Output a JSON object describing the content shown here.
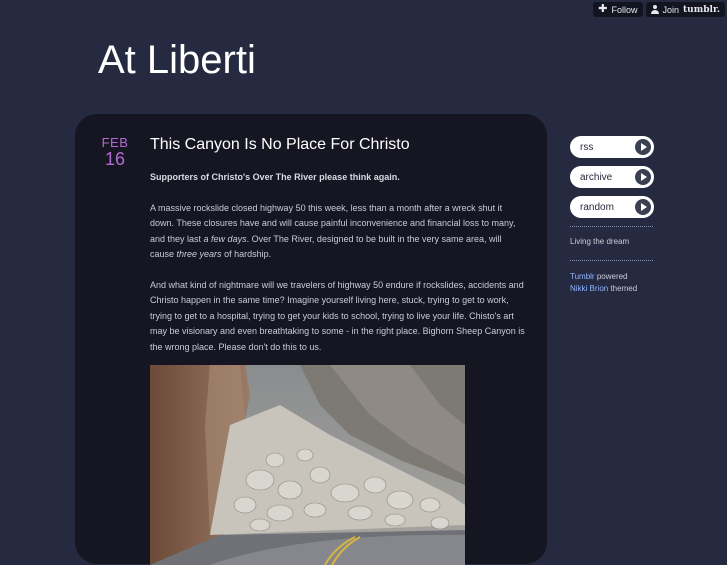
{
  "topbar": {
    "follow_label": "Follow",
    "join_label": "Join",
    "brand": "tumblr."
  },
  "blog": {
    "title": "At Liberti"
  },
  "post": {
    "month": "FEB",
    "day": "16",
    "title": "This Canyon Is No Place For Christo",
    "lead": "Supporters of Christo's Over The River please think again.",
    "p1_a": "A massive rockslide closed highway 50 this week, less than a month after a wreck shut it down. These closures have and will cause painful inconvenience and financial loss to many, and they last ",
    "p1_em": "a few days",
    "p1_b": ". Over The River, designed to be built in the very same area, will cause ",
    "p1_em2": "three years",
    "p1_c": " of hardship.",
    "p2": "And what kind of nightmare will we travelers of highway 50 endure if rockslides, accidents and Christo happen in the same time? Imagine yourself living here, stuck, trying to get to work, trying to get to a hospital, trying to get your kids to school, trying to live your life. Chisto's art may be visionary and even breathtaking to some - in the right place. Bighorn Sheep Canyon is the wrong place. Please don't do this to us."
  },
  "sidebar": {
    "links": [
      {
        "label": "rss",
        "icon": "arrow-right-icon"
      },
      {
        "label": "archive",
        "icon": "arrow-right-icon"
      },
      {
        "label": "random",
        "icon": "arrow-right-icon"
      }
    ],
    "tagline": "Living the dream",
    "credit_tumblr": "Tumblr",
    "credit_powered": " powered",
    "credit_author": "Nikki Brion",
    "credit_themed": " themed"
  },
  "colors": {
    "background": "#262a40",
    "panel": "#151622",
    "date_accent": "#b36ad0",
    "link": "#8fb3ff"
  }
}
